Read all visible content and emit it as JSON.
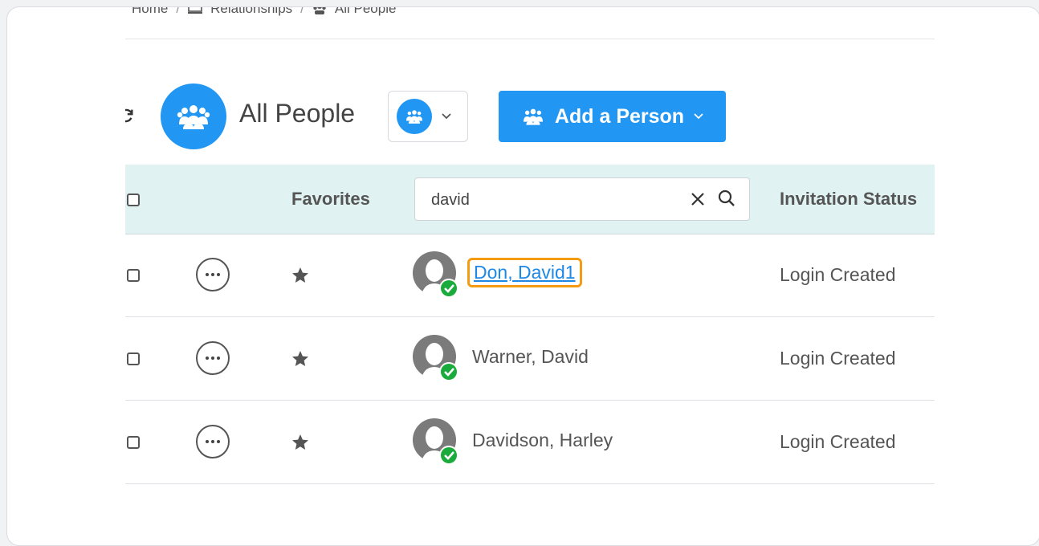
{
  "breadcrumb": {
    "items": [
      "Home",
      "Relationships",
      "All People"
    ],
    "separator": "/"
  },
  "page": {
    "title": "All People"
  },
  "toolbar": {
    "add_button_label": "Add a Person"
  },
  "table": {
    "headers": {
      "favorites": "Favorites",
      "invitation_status": "Invitation Status"
    },
    "search": {
      "value": "david"
    },
    "rows": [
      {
        "name": "Don, David1",
        "status": "Login Created",
        "highlighted": true
      },
      {
        "name": "Warner, David",
        "status": "Login Created",
        "highlighted": false
      },
      {
        "name": "Davidson, Harley",
        "status": "Login Created",
        "highlighted": false
      }
    ]
  },
  "colors": {
    "primary": "#2196f3",
    "header_bg": "#e0f2f1",
    "link": "#1e88e5",
    "highlight_border": "#f39c12",
    "verified_badge": "#1aab3c"
  },
  "icons": {
    "refresh": "refresh-icon",
    "group": "group-icon",
    "chevron": "chevron-down-icon",
    "clear": "close-icon",
    "search": "search-icon",
    "more": "more-options-icon",
    "favorite": "star-icon",
    "avatar": "user-avatar-icon",
    "verified": "check-badge-icon"
  }
}
